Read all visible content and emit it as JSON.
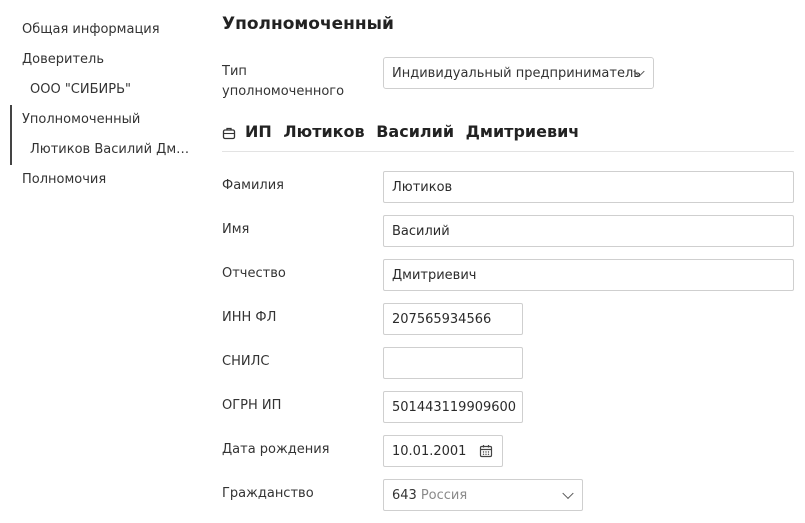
{
  "nav": {
    "items": [
      {
        "label": "Общая информация"
      },
      {
        "label": "Доверитель"
      },
      {
        "label": "ООО \"СИБИРЬ\""
      },
      {
        "label": "Уполномоченный"
      },
      {
        "label": "Лютиков Василий Дмит..."
      },
      {
        "label": "Полномочия"
      }
    ]
  },
  "main": {
    "title": "Уполномоченный",
    "type_label_line1": "Тип",
    "type_label_line2": "уполномоченного",
    "type_value": "Индивидуальный предприниматель",
    "subject_name": "ИП Лютиков Василий Дмитриевич",
    "fields": {
      "lastname": {
        "label": "Фамилия",
        "value": "Лютиков"
      },
      "firstname": {
        "label": "Имя",
        "value": "Василий"
      },
      "patronymic": {
        "label": "Отчество",
        "value": "Дмитриевич"
      },
      "inn": {
        "label": "ИНН ФЛ",
        "value": "207565934566"
      },
      "snils": {
        "label": "СНИЛС",
        "value": ""
      },
      "ogrnip": {
        "label": "ОГРН ИП",
        "value": "501443119909600"
      },
      "birthdate": {
        "label": "Дата рождения",
        "value": "10.01.2001"
      },
      "citizenship": {
        "label": "Гражданство",
        "code": "643",
        "country": "Россия"
      }
    }
  },
  "icons": {
    "subject": "briefcase-icon",
    "date": "calendar-icon",
    "dropdown": "chevron-down-icon"
  }
}
